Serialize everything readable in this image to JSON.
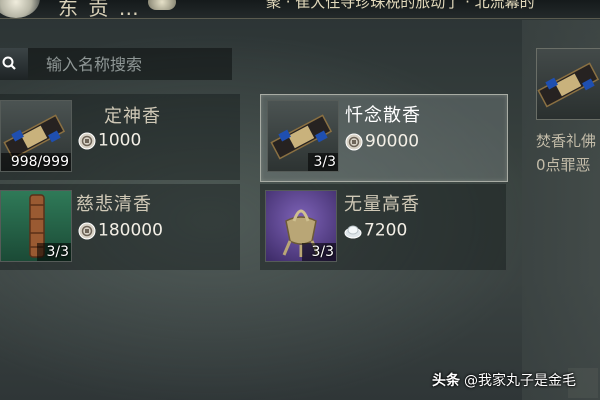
{
  "header": {
    "title": "东 贡 …",
    "ticker": "聚 · 隹大住寺珍珠税的旅动了 · 北流幕的"
  },
  "search": {
    "placeholder": "输入名称搜索"
  },
  "items": [
    {
      "name": "定神香",
      "price": "1000",
      "quantity": "998/999",
      "currency_icon": "coin-icon",
      "selected": false
    },
    {
      "name": "忏念散香",
      "price": "90000",
      "quantity": "3/3",
      "currency_icon": "coin-icon",
      "selected": true
    },
    {
      "name": "慈悲清香",
      "price": "180000",
      "quantity": "3/3",
      "currency_icon": "coin-icon",
      "selected": false
    },
    {
      "name": "无量高香",
      "price": "7200",
      "quantity": "3/3",
      "currency_icon": "silver-icon",
      "selected": false
    }
  ],
  "detail": {
    "line1": "焚香礼佛",
    "line2": "0点罪恶"
  },
  "watermark": {
    "brand": "头条",
    "author": "@我家丸子是金毛"
  }
}
